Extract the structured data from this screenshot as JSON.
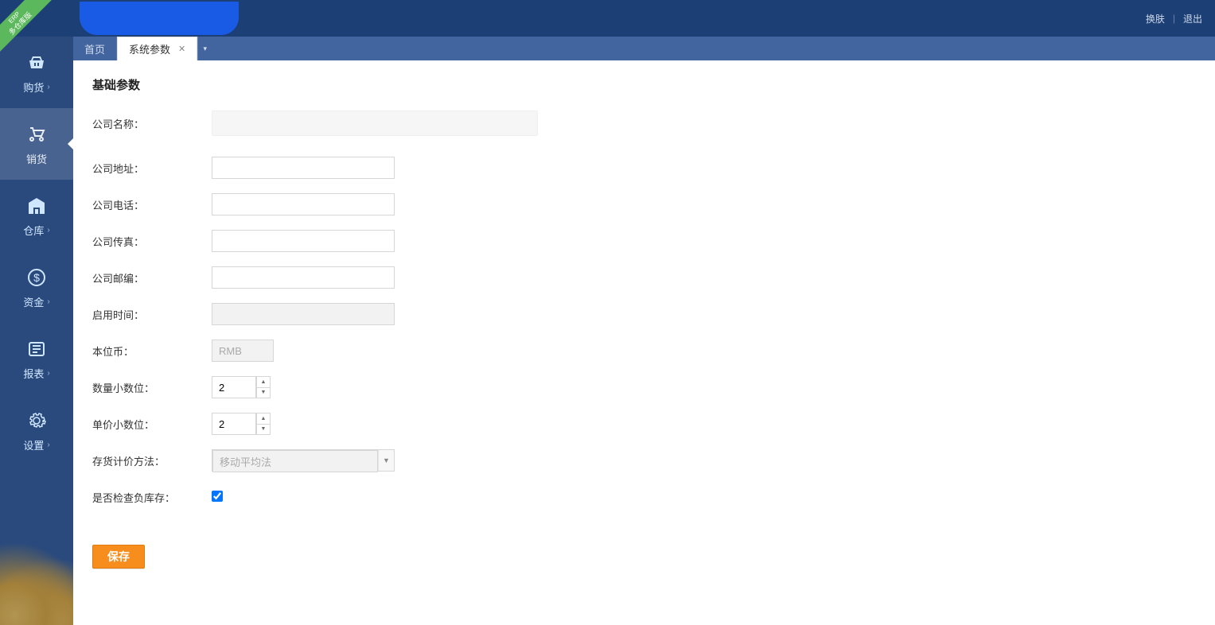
{
  "corner": {
    "line1": "ERP",
    "line2": "多仓库版"
  },
  "topbar": {
    "skin": "换肤",
    "logout": "退出"
  },
  "sidebar": [
    {
      "key": "buy",
      "label": "购货"
    },
    {
      "key": "sell",
      "label": "销货"
    },
    {
      "key": "warehouse",
      "label": "仓库"
    },
    {
      "key": "finance",
      "label": "资金"
    },
    {
      "key": "report",
      "label": "报表"
    },
    {
      "key": "settings",
      "label": "设置"
    }
  ],
  "tabs": {
    "home": "首页",
    "active": "系统参数"
  },
  "section_title": "基础参数",
  "form": {
    "company_name": {
      "label": "公司名称：",
      "value": ""
    },
    "company_address": {
      "label": "公司地址：",
      "value": ""
    },
    "company_phone": {
      "label": "公司电话：",
      "value": ""
    },
    "company_fax": {
      "label": "公司传真：",
      "value": ""
    },
    "company_zip": {
      "label": "公司邮编：",
      "value": ""
    },
    "enable_time": {
      "label": "启用时间：",
      "value": ""
    },
    "base_currency": {
      "label": "本位币：",
      "value": "RMB"
    },
    "qty_decimals": {
      "label": "数量小数位：",
      "value": "2"
    },
    "price_decimals": {
      "label": "单价小数位：",
      "value": "2"
    },
    "costing_method": {
      "label": "存货计价方法：",
      "value": "移动平均法"
    },
    "check_negative": {
      "label": "是否检查负库存：",
      "checked": true
    }
  },
  "save_label": "保存"
}
